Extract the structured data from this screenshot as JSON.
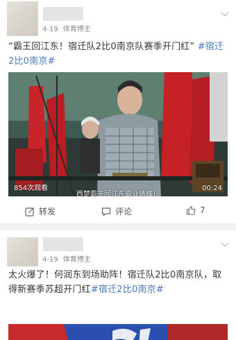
{
  "posts": [
    {
      "date": "4-19",
      "source": "体育博主",
      "text_prefix": "“霸王回江东！宿迁队2比0南京队赛季开门红”",
      "hashtag": "#宿迁2比0南京#",
      "video": {
        "views": "854次观看",
        "duration": "00:24",
        "subtitle": "西楚霸王回江东霸业铸臻！"
      },
      "actions": {
        "repost": "转发",
        "comment": "评论",
        "like": "7"
      }
    },
    {
      "date": "4-19",
      "source": "体育博主",
      "text_prefix": "太火爆了！何润东到场助阵！宿迁队2比0南京队，取得新赛季苏超开门红",
      "hashtag": "#宿迁2比0南京#"
    }
  ]
}
